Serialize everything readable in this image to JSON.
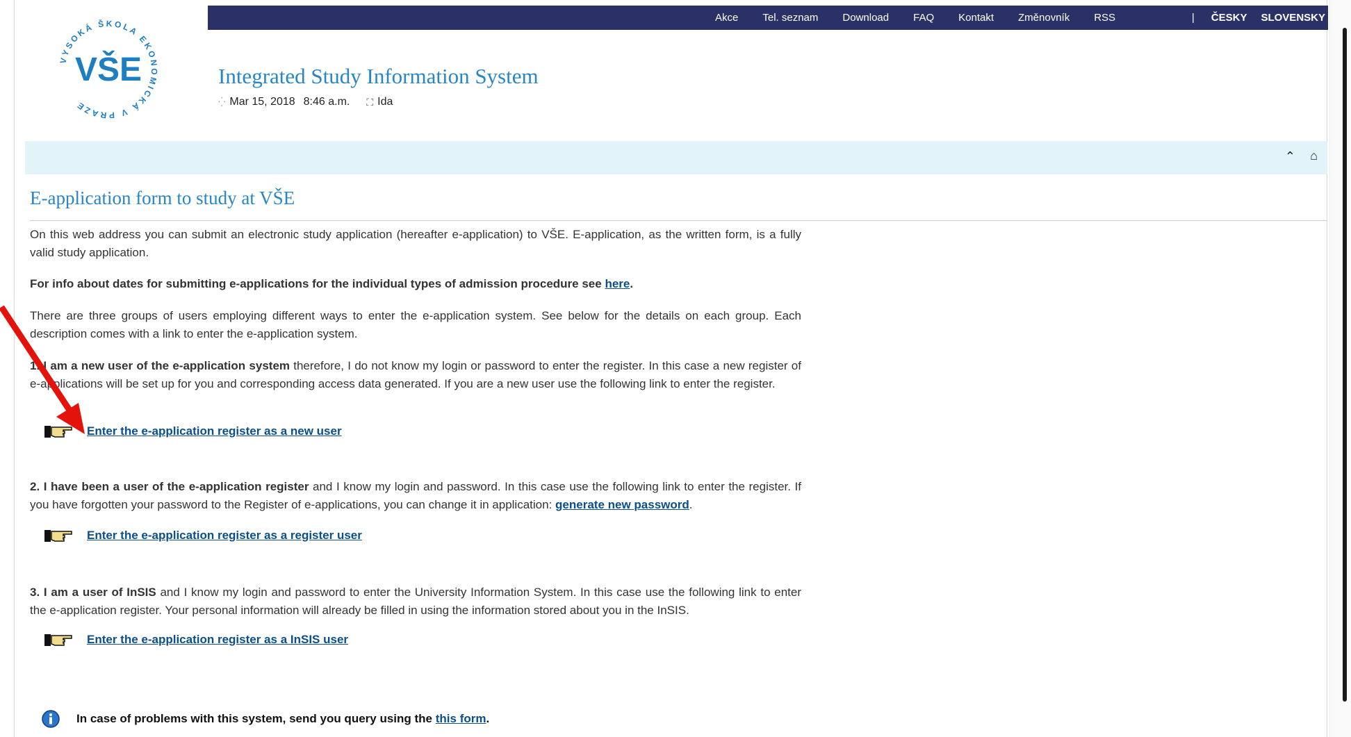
{
  "nav": {
    "links": [
      "Akce",
      "Tel. seznam",
      "Download",
      "FAQ",
      "Kontakt",
      "Změnovník",
      "RSS"
    ],
    "separator": "|",
    "languages": [
      "ČESKY",
      "SLOVENSKY"
    ]
  },
  "logo": {
    "text": "VŠE",
    "ring_text": "VYSOKÁ ŠKOLA EKONOMICKÁ V PRAZE"
  },
  "header": {
    "system_title": "Integrated Study Information System",
    "date": "Mar 15, 2018",
    "time": "8:46 a.m.",
    "user": "Ida"
  },
  "page": {
    "title": "E-application form to study at VŠE",
    "intro": "On this web address you can submit an electronic study application (hereafter e-application) to VŠE. E-application, as the written form, is a fully valid study application.",
    "dates_text": "For info about dates for submitting e-applications for the individual types of admission procedure see",
    "dates_link": "here",
    "groups_text": "There are three groups of users employing different ways to enter the e-application system. See below for the details on each group. Each description comes with a link to enter the e-application system.",
    "group1_bold": "1. I am a new user of the e-application system",
    "group1_text": " therefore, I do not know my login or password to enter the register. In this case a new register of e-applications will be set up for you and corresponding access data generated. If you are a new user use the following link to enter the register.",
    "group1_link": "Enter the e-application register as a new user",
    "group2_bold": "2. I have been a user of the e-application register",
    "group2_text": " and I know my login and password. In this case use the following link to enter the register. If you have forgotten your password to the Register of e-applications, you can change it in application:",
    "group2_inline_link": "generate new password",
    "group2_link": "Enter the e-application register as a register user",
    "group3_bold": "3. I am a user of InSIS",
    "group3_text": " and I know my login and password to enter the University Information System. In this case use the following link to enter the e-application register. Your personal information will already be filled in using the information stored about you in the InSIS.",
    "group3_link": "Enter the e-application register as a InSIS user",
    "help_text": "In case of problems with this system, send you query using the",
    "help_link": "this form"
  },
  "colors": {
    "nav_bg": "#2a3166",
    "title_blue": "#2986c4",
    "link_blue": "#0b4f8a",
    "bar_bg": "#e3f3fa",
    "annotation_arrow": "#e3120b"
  },
  "icons": [
    "clock-icon",
    "user-icon",
    "scroll-up-icon",
    "home-icon",
    "pointing-hand-icon",
    "info-icon",
    "red-arrow-annotation"
  ]
}
